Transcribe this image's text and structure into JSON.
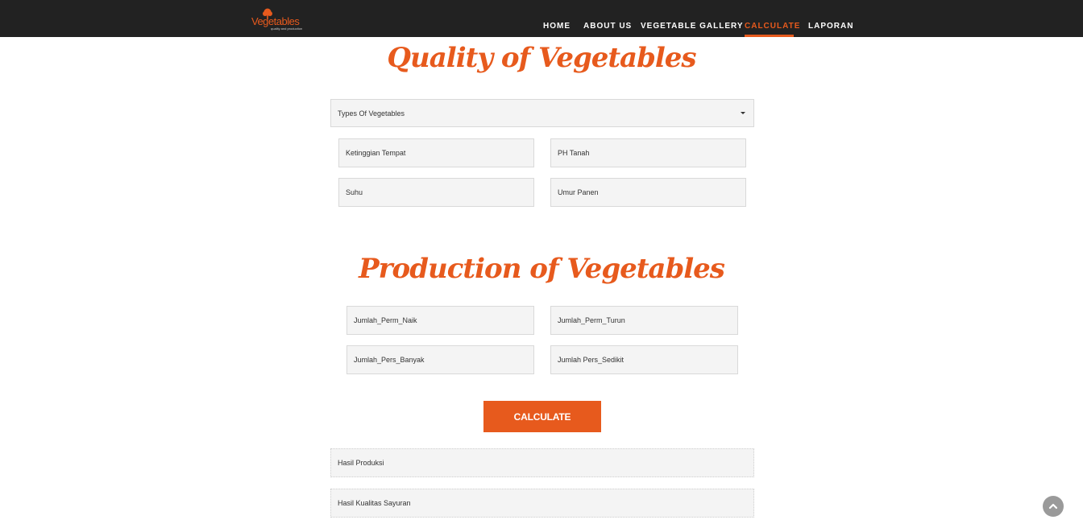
{
  "brand": {
    "name": "Vegetables",
    "tagline": "quality and production",
    "accent_color": "#e75a1d",
    "icon": "tree-icon"
  },
  "nav": {
    "items": [
      {
        "label": "HOME",
        "active": false
      },
      {
        "label": "ABOUT US",
        "active": false
      },
      {
        "label": "VEGETABLE GALLERY",
        "active": false
      },
      {
        "label": "CALCULATE",
        "active": true
      },
      {
        "label": "LAPORAN",
        "active": false
      }
    ]
  },
  "quality": {
    "title": "Quality of Vegetables",
    "type_select": {
      "value": "Types Of Vegetables",
      "icon": "caret-down-icon"
    },
    "fields": [
      "Ketinggian Tempat",
      "PH Tanah",
      "Suhu",
      "Umur Panen"
    ]
  },
  "production": {
    "title": "Production of Vegetables",
    "fields": [
      "Jumlah_Perm_Naik",
      "Jumlah_Perm_Turun",
      "Jumlah_Pers_Banyak",
      "Jumlah Pers_Sedikit"
    ]
  },
  "calculate_button": {
    "label": "CALCULATE"
  },
  "results": {
    "production": "Hasil Produksi",
    "quality": "Hasil Kualitas Sayuran"
  },
  "scroll_top": {
    "icon": "chevron-up-icon"
  }
}
